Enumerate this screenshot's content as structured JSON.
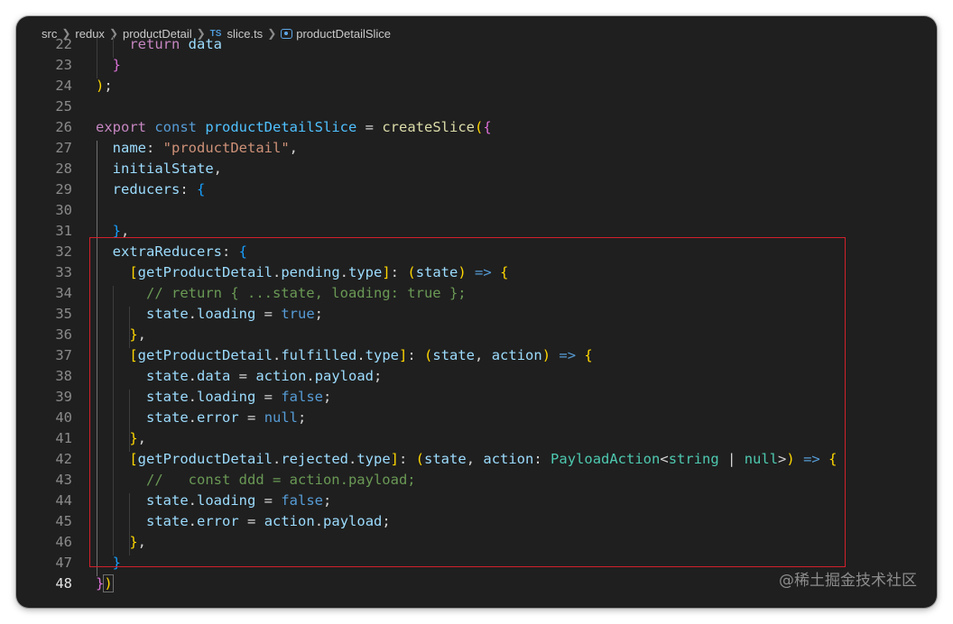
{
  "breadcrumb": {
    "segments": [
      "src",
      "redux",
      "productDetail"
    ],
    "file_badge": "TS",
    "file_name": "slice.ts",
    "symbol": "productDetailSlice",
    "symbol_icon": "symbol-variable-icon"
  },
  "editor": {
    "active_line": "48",
    "lines": [
      {
        "n": "22",
        "tokens": [
          [
            "    ",
            "p"
          ],
          [
            "return",
            "kc"
          ],
          [
            " ",
            "p"
          ],
          [
            "data",
            "v"
          ]
        ]
      },
      {
        "n": "23",
        "tokens": [
          [
            "  ",
            "p"
          ],
          [
            "}",
            "b2"
          ]
        ]
      },
      {
        "n": "24",
        "tokens": [
          [
            ")",
            "b1"
          ],
          [
            ";",
            "p"
          ]
        ]
      },
      {
        "n": "25",
        "tokens": []
      },
      {
        "n": "26",
        "tokens": [
          [
            "export",
            "kc"
          ],
          [
            " ",
            "p"
          ],
          [
            "const",
            "k"
          ],
          [
            " ",
            "p"
          ],
          [
            "productDetailSlice",
            "c"
          ],
          [
            " = ",
            "p"
          ],
          [
            "createSlice",
            "f"
          ],
          [
            "(",
            "b1"
          ],
          [
            "{",
            "b2"
          ]
        ]
      },
      {
        "n": "27",
        "tokens": [
          [
            "  ",
            "p"
          ],
          [
            "name",
            "v"
          ],
          [
            ": ",
            "p"
          ],
          [
            "\"productDetail\"",
            "s"
          ],
          [
            ",",
            "p"
          ]
        ]
      },
      {
        "n": "28",
        "tokens": [
          [
            "  ",
            "p"
          ],
          [
            "initialState",
            "v"
          ],
          [
            ",",
            "p"
          ]
        ]
      },
      {
        "n": "29",
        "tokens": [
          [
            "  ",
            "p"
          ],
          [
            "reducers",
            "v"
          ],
          [
            ": ",
            "p"
          ],
          [
            "{",
            "b3"
          ]
        ]
      },
      {
        "n": "30",
        "tokens": []
      },
      {
        "n": "31",
        "tokens": [
          [
            "  ",
            "p"
          ],
          [
            "}",
            "b3"
          ],
          [
            ",",
            "p"
          ]
        ]
      },
      {
        "n": "32",
        "tokens": [
          [
            "  ",
            "p"
          ],
          [
            "extraReducers",
            "v"
          ],
          [
            ": ",
            "p"
          ],
          [
            "{",
            "b3"
          ]
        ]
      },
      {
        "n": "33",
        "tokens": [
          [
            "    ",
            "p"
          ],
          [
            "[",
            "b1"
          ],
          [
            "getProductDetail",
            "v"
          ],
          [
            ".",
            "p"
          ],
          [
            "pending",
            "v"
          ],
          [
            ".",
            "p"
          ],
          [
            "type",
            "v"
          ],
          [
            "]",
            "b1"
          ],
          [
            ": ",
            "p"
          ],
          [
            "(",
            "b1"
          ],
          [
            "state",
            "v"
          ],
          [
            ")",
            "b1"
          ],
          [
            " ",
            "p"
          ],
          [
            "=>",
            "k"
          ],
          [
            " ",
            "p"
          ],
          [
            "{",
            "b1"
          ]
        ]
      },
      {
        "n": "34",
        "tokens": [
          [
            "      ",
            "p"
          ],
          [
            "// return { ...state, loading: true };",
            "cm"
          ]
        ]
      },
      {
        "n": "35",
        "tokens": [
          [
            "      ",
            "p"
          ],
          [
            "state",
            "v"
          ],
          [
            ".",
            "p"
          ],
          [
            "loading",
            "v"
          ],
          [
            " = ",
            "p"
          ],
          [
            "true",
            "k"
          ],
          [
            ";",
            "p"
          ]
        ]
      },
      {
        "n": "36",
        "tokens": [
          [
            "    ",
            "p"
          ],
          [
            "}",
            "b1"
          ],
          [
            ",",
            "p"
          ]
        ]
      },
      {
        "n": "37",
        "tokens": [
          [
            "    ",
            "p"
          ],
          [
            "[",
            "b1"
          ],
          [
            "getProductDetail",
            "v"
          ],
          [
            ".",
            "p"
          ],
          [
            "fulfilled",
            "v"
          ],
          [
            ".",
            "p"
          ],
          [
            "type",
            "v"
          ],
          [
            "]",
            "b1"
          ],
          [
            ": ",
            "p"
          ],
          [
            "(",
            "b1"
          ],
          [
            "state",
            "v"
          ],
          [
            ", ",
            "p"
          ],
          [
            "action",
            "v"
          ],
          [
            ")",
            "b1"
          ],
          [
            " ",
            "p"
          ],
          [
            "=>",
            "k"
          ],
          [
            " ",
            "p"
          ],
          [
            "{",
            "b1"
          ]
        ]
      },
      {
        "n": "38",
        "tokens": [
          [
            "      ",
            "p"
          ],
          [
            "state",
            "v"
          ],
          [
            ".",
            "p"
          ],
          [
            "data",
            "v"
          ],
          [
            " = ",
            "p"
          ],
          [
            "action",
            "v"
          ],
          [
            ".",
            "p"
          ],
          [
            "payload",
            "v"
          ],
          [
            ";",
            "p"
          ]
        ]
      },
      {
        "n": "39",
        "tokens": [
          [
            "      ",
            "p"
          ],
          [
            "state",
            "v"
          ],
          [
            ".",
            "p"
          ],
          [
            "loading",
            "v"
          ],
          [
            " = ",
            "p"
          ],
          [
            "false",
            "k"
          ],
          [
            ";",
            "p"
          ]
        ]
      },
      {
        "n": "40",
        "tokens": [
          [
            "      ",
            "p"
          ],
          [
            "state",
            "v"
          ],
          [
            ".",
            "p"
          ],
          [
            "error",
            "v"
          ],
          [
            " = ",
            "p"
          ],
          [
            "null",
            "k"
          ],
          [
            ";",
            "p"
          ]
        ]
      },
      {
        "n": "41",
        "tokens": [
          [
            "    ",
            "p"
          ],
          [
            "}",
            "b1"
          ],
          [
            ",",
            "p"
          ]
        ]
      },
      {
        "n": "42",
        "tokens": [
          [
            "    ",
            "p"
          ],
          [
            "[",
            "b1"
          ],
          [
            "getProductDetail",
            "v"
          ],
          [
            ".",
            "p"
          ],
          [
            "rejected",
            "v"
          ],
          [
            ".",
            "p"
          ],
          [
            "type",
            "v"
          ],
          [
            "]",
            "b1"
          ],
          [
            ": ",
            "p"
          ],
          [
            "(",
            "b1"
          ],
          [
            "state",
            "v"
          ],
          [
            ", ",
            "p"
          ],
          [
            "action",
            "v"
          ],
          [
            ": ",
            "p"
          ],
          [
            "PayloadAction",
            "t"
          ],
          [
            "<",
            "p"
          ],
          [
            "string",
            "t"
          ],
          [
            " | ",
            "p"
          ],
          [
            "null",
            "t"
          ],
          [
            ">",
            "p"
          ],
          [
            ")",
            "b1"
          ],
          [
            " ",
            "p"
          ],
          [
            "=>",
            "k"
          ],
          [
            " ",
            "p"
          ],
          [
            "{",
            "b1"
          ]
        ]
      },
      {
        "n": "43",
        "tokens": [
          [
            "      ",
            "p"
          ],
          [
            "//   const ddd = action.payload;",
            "cm"
          ]
        ]
      },
      {
        "n": "44",
        "tokens": [
          [
            "      ",
            "p"
          ],
          [
            "state",
            "v"
          ],
          [
            ".",
            "p"
          ],
          [
            "loading",
            "v"
          ],
          [
            " = ",
            "p"
          ],
          [
            "false",
            "k"
          ],
          [
            ";",
            "p"
          ]
        ]
      },
      {
        "n": "45",
        "tokens": [
          [
            "      ",
            "p"
          ],
          [
            "state",
            "v"
          ],
          [
            ".",
            "p"
          ],
          [
            "error",
            "v"
          ],
          [
            " = ",
            "p"
          ],
          [
            "action",
            "v"
          ],
          [
            ".",
            "p"
          ],
          [
            "payload",
            "v"
          ],
          [
            ";",
            "p"
          ]
        ]
      },
      {
        "n": "46",
        "tokens": [
          [
            "    ",
            "p"
          ],
          [
            "}",
            "b1"
          ],
          [
            ",",
            "p"
          ]
        ]
      },
      {
        "n": "47",
        "tokens": [
          [
            "  ",
            "p"
          ],
          [
            "}",
            "b3"
          ]
        ]
      },
      {
        "n": "48",
        "tokens": [
          [
            "}",
            "b2"
          ],
          [
            ")",
            "b1"
          ]
        ]
      }
    ]
  },
  "watermark": "@稀土掘金技术社区",
  "colors": {
    "editor_bg": "#1f1f1f",
    "highlight_box": "#d2202b",
    "keyword": "#569cd6",
    "control_keyword": "#c586c0",
    "variable": "#9cdcfe",
    "function": "#dcdcaa",
    "string": "#ce9178",
    "comment": "#6a9955",
    "type": "#4ec9b0"
  }
}
